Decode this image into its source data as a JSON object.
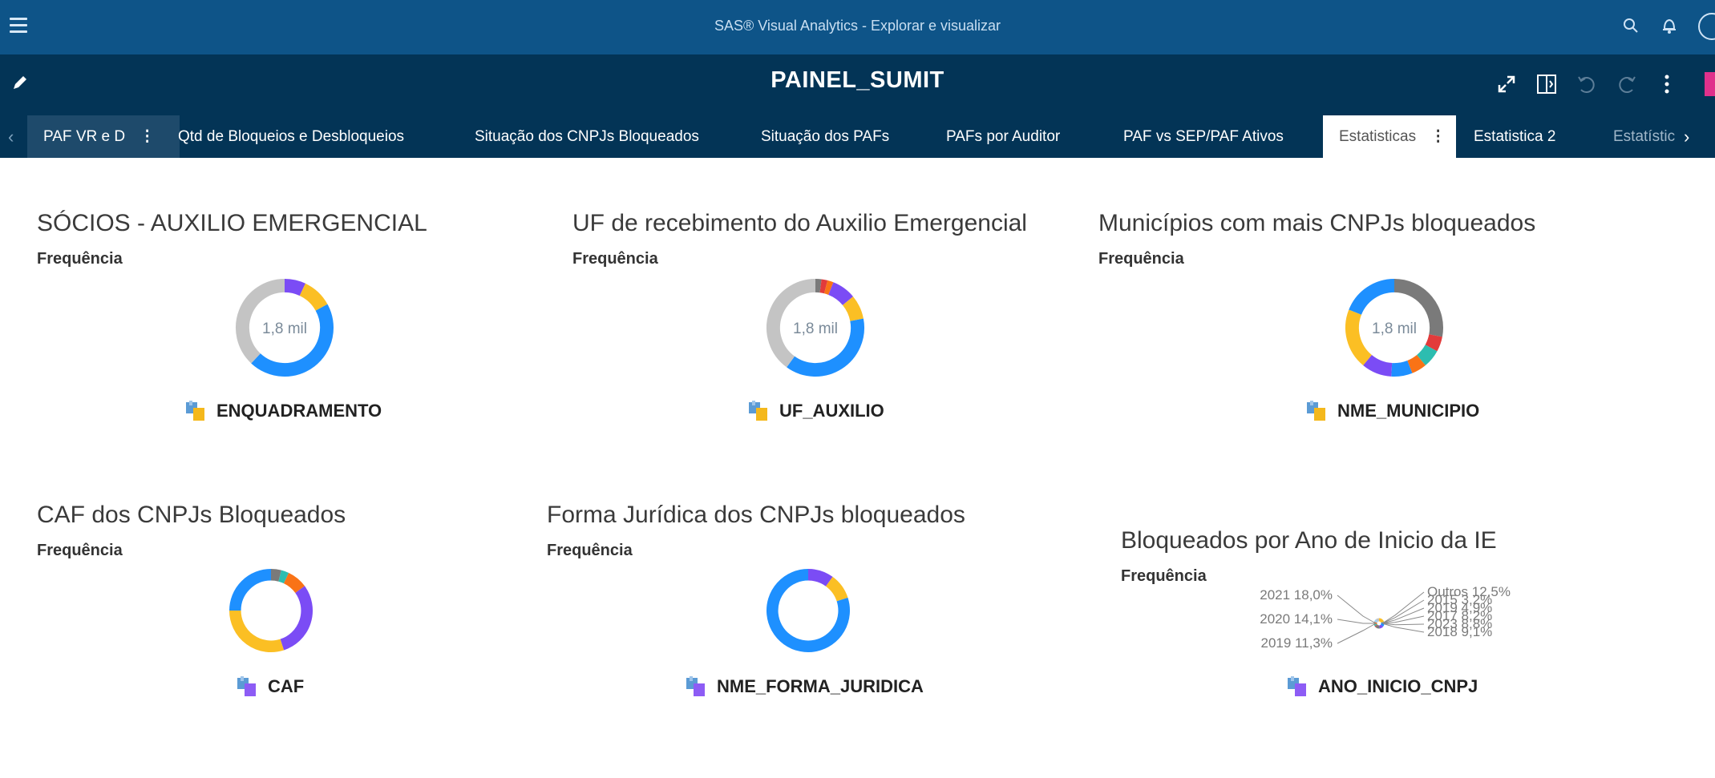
{
  "app": {
    "title": "SAS® Visual Analytics - Explorar e visualizar"
  },
  "report": {
    "title": "PAINEL_SUMIT"
  },
  "tabs": [
    {
      "label": "PAF VR e D",
      "active": false
    },
    {
      "label": "Qtd de Bloqueios e Desbloqueios",
      "active": false
    },
    {
      "label": "Situação dos CNPJs Bloqueados",
      "active": false
    },
    {
      "label": "Situação dos PAFs",
      "active": false
    },
    {
      "label": "PAFs por Auditor",
      "active": false
    },
    {
      "label": "PAF vs SEP/PAF Ativos",
      "active": false
    },
    {
      "label": "Estatisticas",
      "active": true
    },
    {
      "label": "Estatistica 2",
      "active": false
    },
    {
      "label": "Estatístic",
      "active": false
    }
  ],
  "icons": {
    "menu": "hamburger-icon",
    "search": "search-icon",
    "bell": "bell-icon",
    "edit": "pencil-icon",
    "maximize": "expand-icon",
    "panel": "panel-toggle-icon",
    "undo": "undo-icon",
    "redo": "redo-icon",
    "more": "more-icon"
  },
  "colors": {
    "header_bg": "#0e5488",
    "subheader_bg": "#033456",
    "blue": "#1e90ff",
    "yellow": "#fbbf24",
    "purple": "#7b4cf5",
    "gray": "#c4c4c4",
    "darkgray": "#7a7a7a",
    "orange": "#f97316",
    "teal": "#2dbdb0",
    "red": "#e23b3b"
  },
  "cards": [
    {
      "title": "SÓCIOS - AUXILIO EMERGENCIAL",
      "measure": "Frequência",
      "center": "1,8 mil",
      "category": "ENQUADRAMENTO"
    },
    {
      "title": "UF de recebimento do Auxilio Emergencial",
      "measure": "Frequência",
      "center": "1,8 mil",
      "category": "UF_AUXILIO"
    },
    {
      "title": "Municípios com mais CNPJs bloqueados",
      "measure": "Frequência",
      "center": "1,8 mil",
      "category": "NME_MUNICIPIO"
    },
    {
      "title": "CAF dos CNPJs Bloqueados",
      "measure": "Frequência",
      "center": "",
      "category": "CAF"
    },
    {
      "title": "Forma Jurídica dos CNPJs bloqueados",
      "measure": "Frequência",
      "center": "",
      "category": "NME_FORMA_JURIDICA"
    },
    {
      "title": "Bloqueados por Ano de Inicio da IE",
      "measure": "Frequência",
      "center": "",
      "category": "ANO_INICIO_CNPJ"
    }
  ],
  "chart_data": [
    {
      "type": "pie",
      "title": "SÓCIOS - AUXILIO EMERGENCIAL",
      "donut": true,
      "values": [
        0.07,
        0.1,
        0.45,
        0.38
      ],
      "colors": [
        "#7b4cf5",
        "#fbbf24",
        "#1e90ff",
        "#c4c4c4"
      ]
    },
    {
      "type": "pie",
      "title": "UF de recebimento do Auxilio Emergencial",
      "donut": true,
      "values": [
        0.02,
        0.02,
        0.02,
        0.08,
        0.08,
        0.38,
        0.4
      ],
      "colors": [
        "#7a7a7a",
        "#e23b3b",
        "#f97316",
        "#7b4cf5",
        "#fbbf24",
        "#1e90ff",
        "#c4c4c4"
      ]
    },
    {
      "type": "pie",
      "title": "Municípios com mais CNPJs bloqueados",
      "donut": true,
      "values": [
        0.28,
        0.05,
        0.06,
        0.05,
        0.07,
        0.1,
        0.2,
        0.19
      ],
      "colors": [
        "#7a7a7a",
        "#e23b3b",
        "#2dbdb0",
        "#f97316",
        "#1e90ff",
        "#7b4cf5",
        "#fbbf24",
        "#1e90ff"
      ]
    },
    {
      "type": "pie",
      "title": "CAF dos CNPJs Bloqueados",
      "donut": true,
      "values": [
        0.04,
        0.03,
        0.08,
        0.3,
        0.3,
        0.25
      ],
      "colors": [
        "#7a7a7a",
        "#2dbdb0",
        "#f97316",
        "#7b4cf5",
        "#fbbf24",
        "#1e90ff"
      ]
    },
    {
      "type": "pie",
      "title": "Forma Jurídica dos CNPJs bloqueados",
      "donut": true,
      "values": [
        0.1,
        0.1,
        0.8
      ],
      "colors": [
        "#7b4cf5",
        "#fbbf24",
        "#1e90ff"
      ]
    },
    {
      "type": "pie",
      "title": "Bloqueados por Ano de Inicio da IE",
      "donut": true,
      "labels": [
        "2021 18,0%",
        "2020 14,1%",
        "2019 11,3%",
        "Outros 12,5%",
        "2015 3,2%",
        "2019 4,9%",
        "2017 8,2%",
        "2023 8,8%",
        "2018 9,1%"
      ],
      "values": [
        18.0,
        14.1,
        11.3,
        12.5,
        3.2,
        4.9,
        8.2,
        8.8,
        9.1
      ]
    }
  ]
}
